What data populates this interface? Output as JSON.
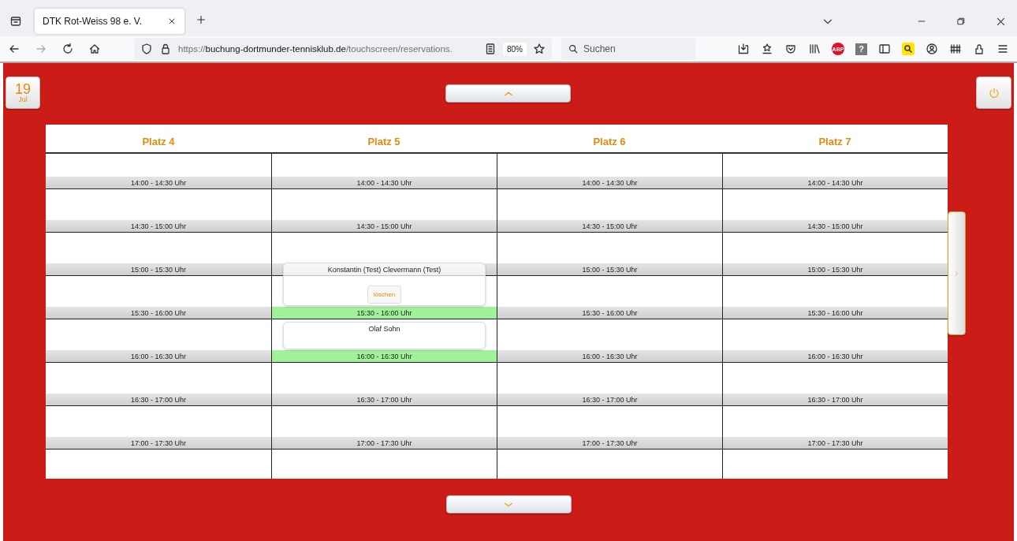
{
  "browser": {
    "tab_title": "DTK Rot-Weiss 98 e. V.",
    "url_scheme": "https://",
    "url_host": "buchung-dortmunder-tennisklub.de",
    "url_path": "/touchscreen/reservations.",
    "zoom": "80%",
    "search_placeholder": "Suchen",
    "adblock_badge": "ABP",
    "help_glyph": "?"
  },
  "date": {
    "day": "19",
    "month": "Jul"
  },
  "courts": [
    {
      "title": "Platz 4",
      "slots": [
        {
          "time": "14:00 - 14:30 Uhr",
          "booked": false
        },
        {
          "time": "14:30 - 15:00 Uhr",
          "booked": false
        },
        {
          "time": "15:00 - 15:30 Uhr",
          "booked": false
        },
        {
          "time": "15:30 - 16:00 Uhr",
          "booked": false
        },
        {
          "time": "16:00 - 16:30 Uhr",
          "booked": false
        },
        {
          "time": "16:30 - 17:00 Uhr",
          "booked": false
        },
        {
          "time": "17:00 - 17:30 Uhr",
          "booked": false
        }
      ]
    },
    {
      "title": "Platz 5",
      "slots": [
        {
          "time": "14:00 - 14:30 Uhr",
          "booked": false
        },
        {
          "time": "14:30 - 15:00 Uhr",
          "booked": false
        },
        {
          "booked": false
        },
        {
          "time": "15:30 - 16:00 Uhr",
          "booked": true,
          "booking": {
            "name": "Konstantin (Test) Clevermann (Test)",
            "action": "löschen"
          }
        },
        {
          "time": "16:00 - 16:30 Uhr",
          "booked": true,
          "booking": {
            "name": "Olaf Sohn"
          }
        },
        {
          "time": "16:30 - 17:00 Uhr",
          "booked": false
        },
        {
          "time": "17:00 - 17:30 Uhr",
          "booked": false
        }
      ]
    },
    {
      "title": "Platz 6",
      "slots": [
        {
          "time": "14:00 - 14:30 Uhr",
          "booked": false
        },
        {
          "time": "14:30 - 15:00 Uhr",
          "booked": false
        },
        {
          "time": "15:00 - 15:30 Uhr",
          "booked": false
        },
        {
          "time": "15:30 - 16:00 Uhr",
          "booked": false
        },
        {
          "time": "16:00 - 16:30 Uhr",
          "booked": false
        },
        {
          "time": "16:30 - 17:00 Uhr",
          "booked": false
        },
        {
          "time": "17:00 - 17:30 Uhr",
          "booked": false
        }
      ]
    },
    {
      "title": "Platz 7",
      "slots": [
        {
          "time": "14:00 - 14:30 Uhr",
          "booked": false
        },
        {
          "time": "14:30 - 15:00 Uhr",
          "booked": false
        },
        {
          "time": "15:00 - 15:30 Uhr",
          "booked": false
        },
        {
          "time": "15:30 - 16:00 Uhr",
          "booked": false
        },
        {
          "time": "16:00 - 16:30 Uhr",
          "booked": false
        },
        {
          "time": "16:30 - 17:00 Uhr",
          "booked": false
        },
        {
          "time": "17:00 - 17:30 Uhr",
          "booked": false
        }
      ]
    }
  ]
}
